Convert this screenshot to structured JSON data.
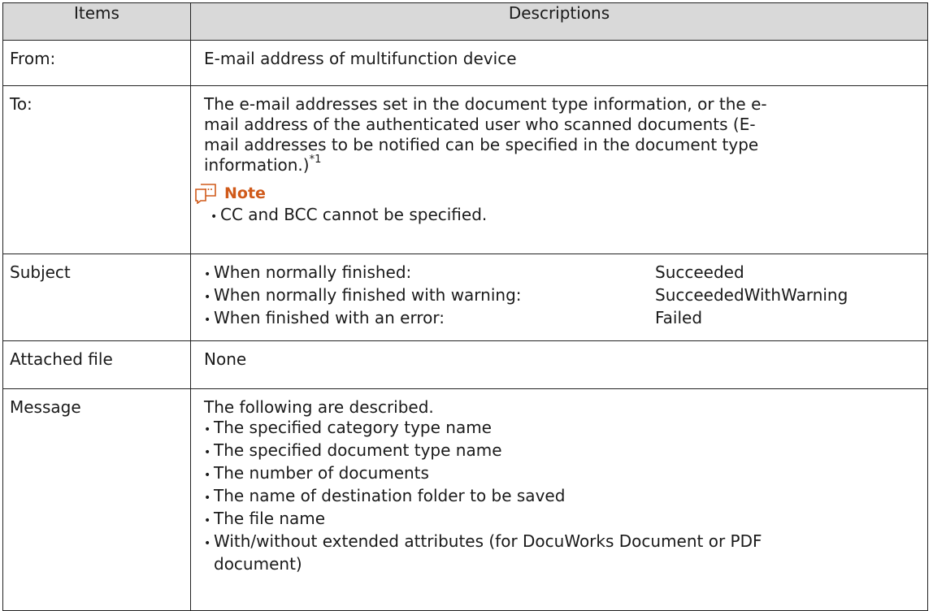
{
  "table": {
    "headers": [
      "Items",
      "Descriptions"
    ],
    "from": {
      "label": "From:",
      "value": "E-mail address of multifunction device"
    },
    "to": {
      "label": "To:",
      "lines": [
        "The e-mail addresses set in the document type information, or the e-",
        "mail address of the authenticated user who scanned documents (E-",
        "mail addresses to be notified can be specified in the document type",
        "information.)"
      ],
      "footnote": "*1",
      "note_title": "Note",
      "note_item": "CC and BCC cannot be specified."
    },
    "subject": {
      "label": "Subject",
      "rows": [
        {
          "condition": "When normally finished:",
          "value": "Succeeded"
        },
        {
          "condition": "When normally finished with warning:",
          "value": "SucceededWithWarning"
        },
        {
          "condition": "When finished with an error:",
          "value": "Failed"
        }
      ]
    },
    "attached": {
      "label": "Attached file",
      "value": "None"
    },
    "message": {
      "label": "Message",
      "intro": "The following are described.",
      "items": [
        "The specified category type name",
        "The specified document type name",
        "The number of documents",
        "The name of destination folder to be saved",
        "The file name",
        "With/without extended attributes (for DocuWorks Document or PDF"
      ],
      "continuation": "document)"
    }
  },
  "colors": {
    "header_bg": "#d9d9d9",
    "note_accent": "#d05a1a",
    "border": "#222222"
  },
  "icons": {
    "note": "note-speech-icon"
  }
}
